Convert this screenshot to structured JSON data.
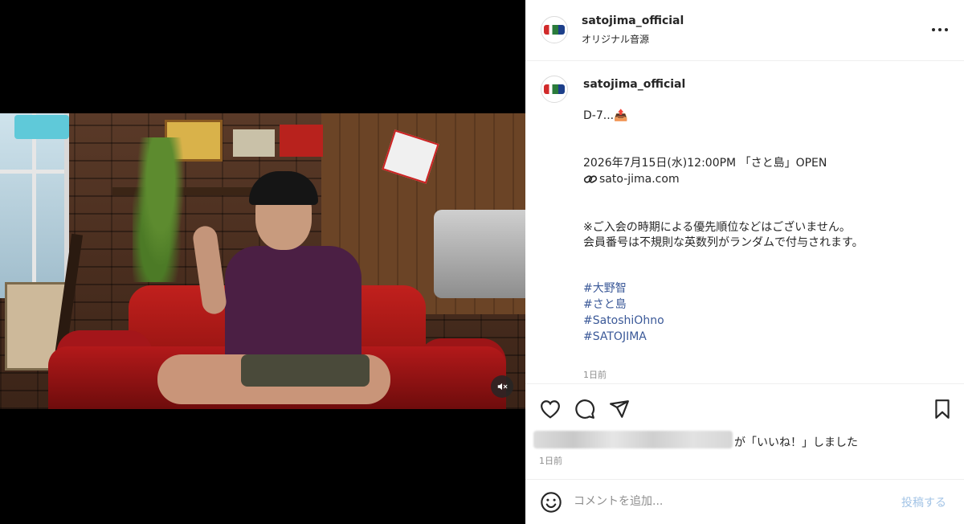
{
  "header": {
    "username": "satojima_official",
    "audio_label": "オリジナル音源",
    "avatar_icon": "brand-logo",
    "more_icon": "more-horizontal-icon"
  },
  "caption": {
    "username": "satojima_official",
    "line1": "D-7...📤",
    "line2": "2026年7月15日(水)12:00PM 「さと島」OPEN",
    "link_text": "sato-jima.com",
    "link_icon": "link-icon",
    "line3": "※ご入会の時期による優先順位などはございません。",
    "line4": "会員番号は不規則な英数列がランダムで付与されます。",
    "hashtags": [
      "#大野智",
      "#さと島",
      "#SatoshiOhno",
      "#SATOJIMA"
    ],
    "time_ago": "1日前"
  },
  "actions": {
    "like_icon": "heart-icon",
    "comment_icon": "comment-icon",
    "share_icon": "send-icon",
    "save_icon": "bookmark-icon"
  },
  "likes": {
    "text": "が「いいね！」しました",
    "time_ago": "1日前"
  },
  "comment": {
    "placeholder": "コメントを追加...",
    "post_label": "投稿する",
    "emoji_icon": "smiley-icon"
  },
  "media": {
    "mute_icon": "speaker-muted-icon"
  },
  "colors": {
    "hashtag": "#3b5998",
    "post_button_disabled": "#a3c4e6",
    "secondary_text": "#8e8e8e"
  }
}
